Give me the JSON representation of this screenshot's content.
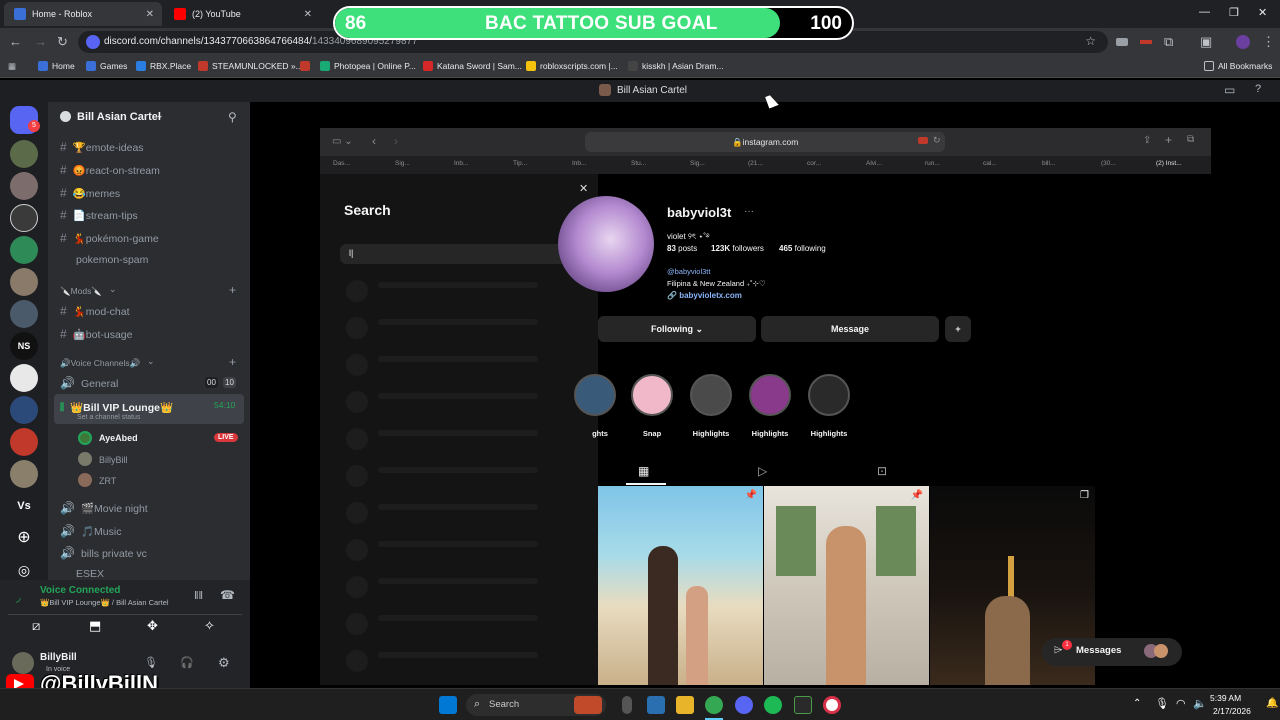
{
  "browser": {
    "tabs": [
      {
        "label": "Home - Roblox"
      },
      {
        "label": "(2) YouTube"
      }
    ],
    "url_main": "discord.com/channels/1343770663864766484/",
    "url_rest": "1433409689095279877",
    "bookmarks": [
      "Home",
      "Games",
      "RBX.Place",
      "STEAMUNLOCKED »...",
      "Photopea | Online P...",
      "Katana Sword | Sam...",
      "robloxscripts.com |...",
      "kisskh | Asian Dram..."
    ],
    "all_bookmarks": "All Bookmarks"
  },
  "goal": {
    "current": "86",
    "title": "BAC TATTOO SUB GOAL",
    "target": "100",
    "progress": 0.86,
    "fill_color": "#3de07a"
  },
  "discord": {
    "window_title": "Bill Asian Cartel",
    "server_name": "Bill Asian Cartel",
    "notif_badge": "5",
    "channels": [
      {
        "label": "🏆emote-ideas"
      },
      {
        "label": "😡react-on-stream"
      },
      {
        "label": "😂memes"
      },
      {
        "label": "📄stream-tips"
      },
      {
        "label": "💃pokémon-game"
      },
      {
        "label": "pokemon-spam"
      }
    ],
    "mods_category": "🔪Mods🔪",
    "mod_channels": [
      {
        "label": "💃mod-chat"
      },
      {
        "label": "🤖bot-usage"
      }
    ],
    "voice_category": "🔊Voice Channels🔊",
    "voice_channels": {
      "general": "General",
      "general_count_a": "00",
      "general_count_b": "10",
      "vip": "👑Bill VIP Lounge👑",
      "vip_time": "54:10",
      "vip_status": "Set a channel status",
      "members": [
        {
          "name": "AyeAbed",
          "badge": "LIVE"
        },
        {
          "name": "BillyBill",
          "badge": ""
        },
        {
          "name": "ZRT",
          "badge": ""
        }
      ],
      "movie": "🎬Movie night",
      "music": "🎵Music",
      "private": "bills private vc",
      "esex": "ESEX"
    },
    "voice_connected": "Voice Connected",
    "voice_location": "👑Bill VIP Lounge👑 / Bill Asian Cartel",
    "user_name": "BillyBill",
    "user_status": "In voice",
    "guild_ns": "NS",
    "guild_vs": "Vs"
  },
  "streamer_handle": "@BillyBillN",
  "shared_screen": {
    "domain": "instagram.com",
    "safari_tabs": [
      "Das...",
      "Sig...",
      "Inb...",
      "Tip...",
      "Inb...",
      "Stu...",
      "Sig...",
      "(21...",
      "cor...",
      "Alvi...",
      "run...",
      "cal...",
      "bill...",
      "(30...",
      "(2) Inst..."
    ],
    "search_title": "Search",
    "search_value": "l|",
    "profile": {
      "username": "babyviol3t",
      "display_name": "violet ୨ৎ ⋆˚࿔",
      "posts": "83",
      "posts_label": "posts",
      "followers": "123K",
      "followers_label": "followers",
      "following": "465",
      "following_label": "following",
      "handle": "@babyviol3tt",
      "bio": "Filipina & New Zealand ₊˚⊹♡",
      "link": "babyvioletx.com",
      "follow_btn": "Following",
      "message_btn": "Message",
      "highlights": [
        {
          "label": "ghts"
        },
        {
          "label": "Snap"
        },
        {
          "label": "Highlights"
        },
        {
          "label": "Highlights"
        },
        {
          "label": "Highlights"
        }
      ],
      "messages_label": "Messages",
      "messages_badge": "1"
    }
  },
  "taskbar": {
    "search_placeholder": "Search",
    "time": "5:39 AM",
    "date": "2/17/2026"
  }
}
